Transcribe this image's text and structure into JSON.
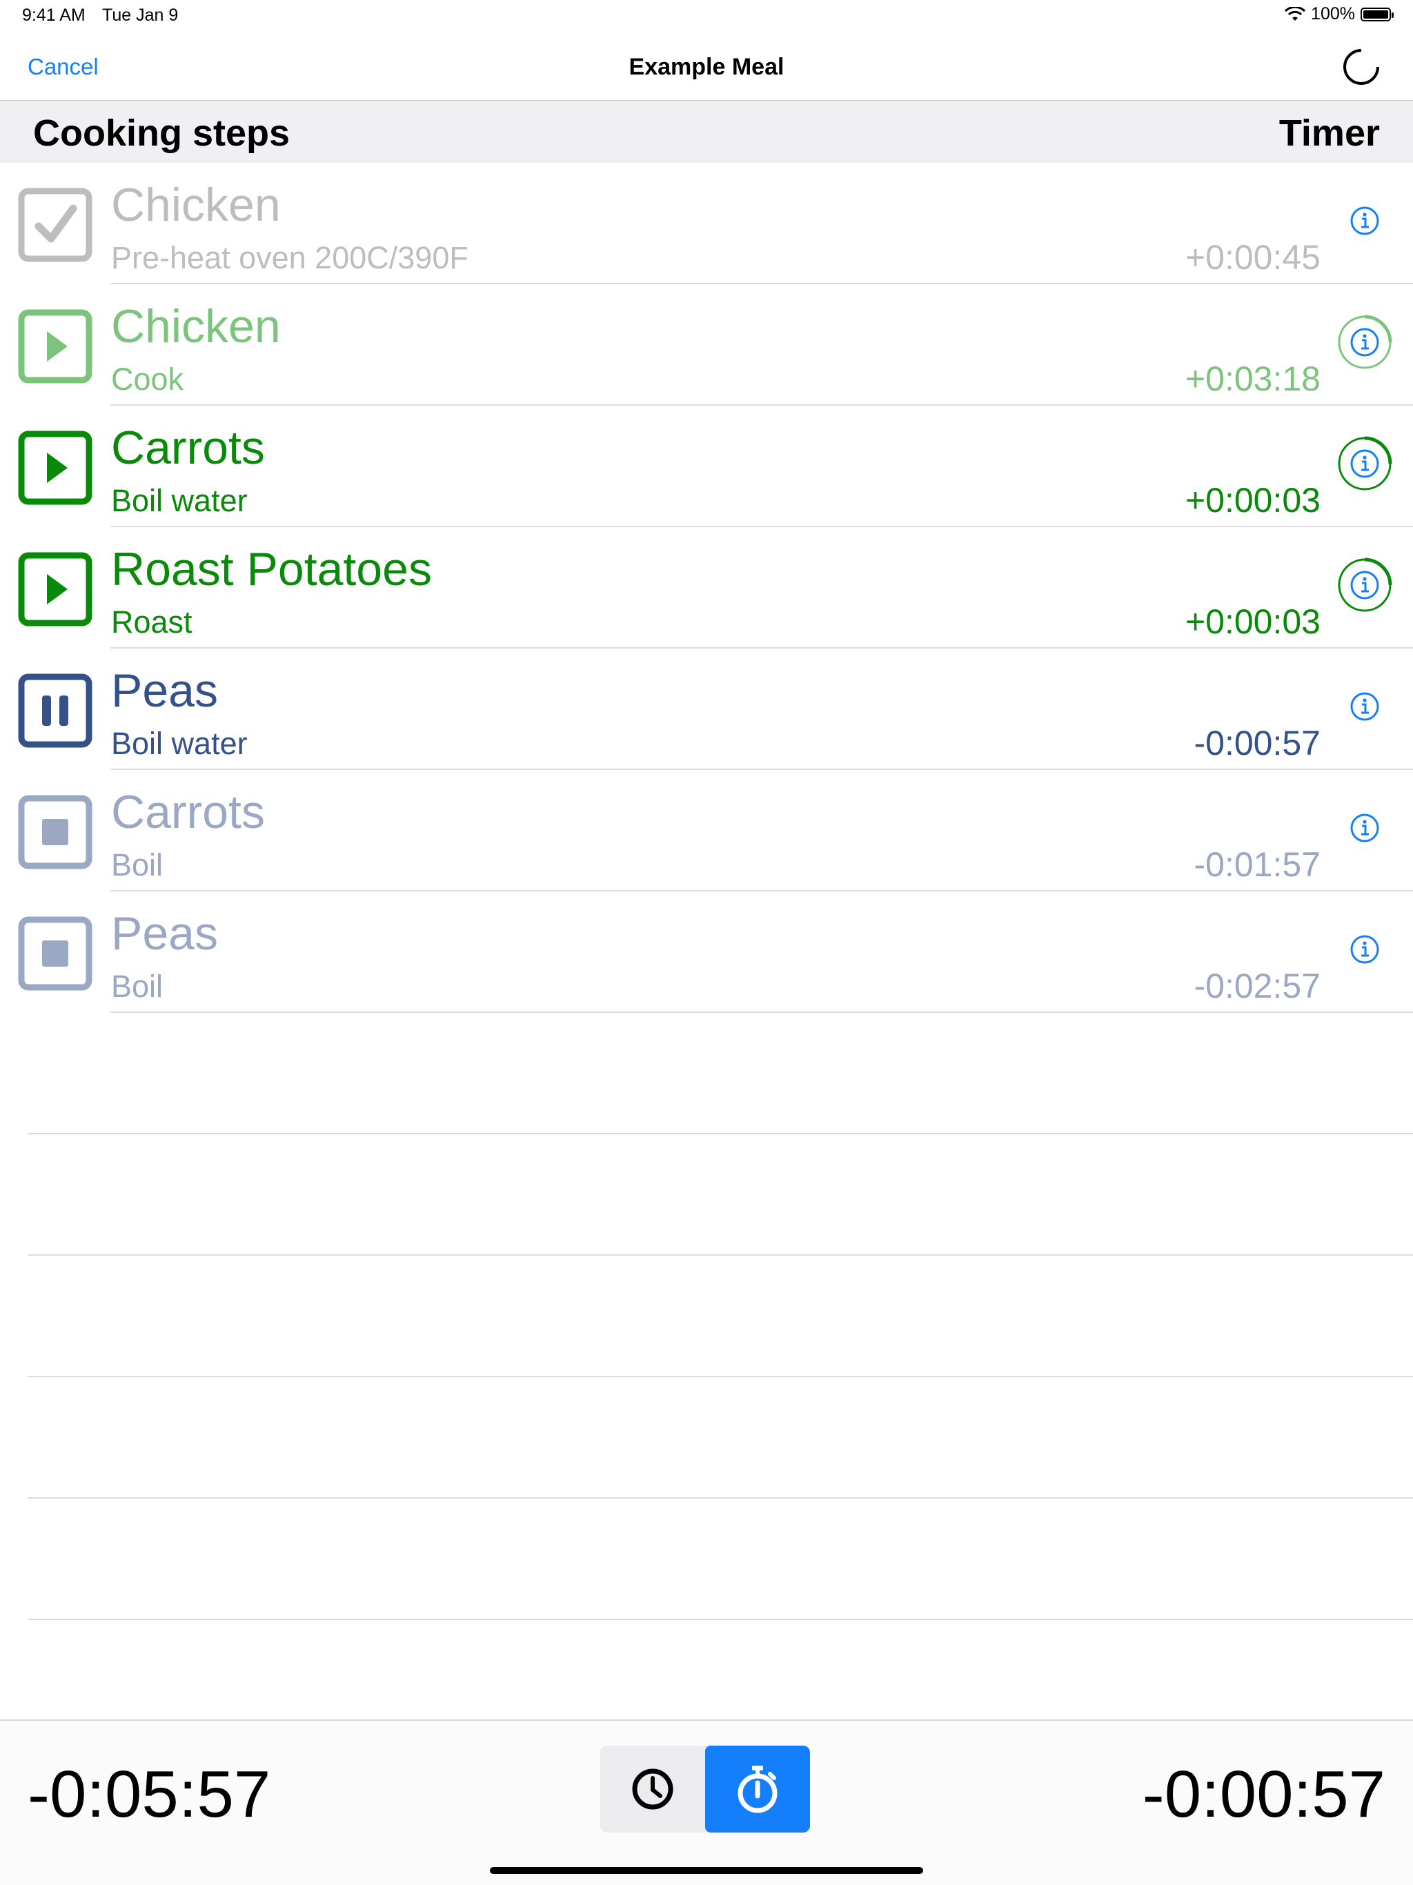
{
  "status": {
    "time": "9:41 AM",
    "date": "Tue Jan 9",
    "battery": "100%"
  },
  "nav": {
    "cancel": "Cancel",
    "title": "Example Meal",
    "spinner_icon": "loading-spinner-icon"
  },
  "section": {
    "left": "Cooking steps",
    "right": "Timer"
  },
  "steps": [
    {
      "name": "Chicken",
      "sub": "Pre-heat oven 200C/390F",
      "time": "+0:00:45",
      "state": "done",
      "color": "#bdbdbd",
      "icon": "checkbox-checked-icon",
      "info_ring": false
    },
    {
      "name": "Chicken",
      "sub": "Cook",
      "time": "+0:03:18",
      "state": "running",
      "color": "#7cc47c",
      "icon": "play-icon",
      "info_ring": true
    },
    {
      "name": "Carrots",
      "sub": "Boil water",
      "time": "+0:00:03",
      "state": "running",
      "color": "#0a8a0a",
      "icon": "play-icon",
      "info_ring": true
    },
    {
      "name": "Roast Potatoes",
      "sub": "Roast",
      "time": "+0:00:03",
      "state": "running",
      "color": "#0a8a0a",
      "icon": "play-icon",
      "info_ring": true
    },
    {
      "name": "Peas",
      "sub": "Boil water",
      "time": "-0:00:57",
      "state": "paused",
      "color": "#34518a",
      "icon": "pause-icon",
      "info_ring": false
    },
    {
      "name": "Carrots",
      "sub": "Boil",
      "time": "-0:01:57",
      "state": "waiting",
      "color": "#9aa8c4",
      "icon": "stop-icon",
      "info_ring": false
    },
    {
      "name": "Peas",
      "sub": "Boil",
      "time": "-0:02:57",
      "state": "waiting",
      "color": "#9aa8c4",
      "icon": "stop-icon",
      "info_ring": false
    }
  ],
  "bottom": {
    "left_time": "-0:05:57",
    "right_time": "-0:00:57",
    "seg_clock": "clock-icon",
    "seg_stopwatch": "stopwatch-icon",
    "accent": "#147efb"
  }
}
